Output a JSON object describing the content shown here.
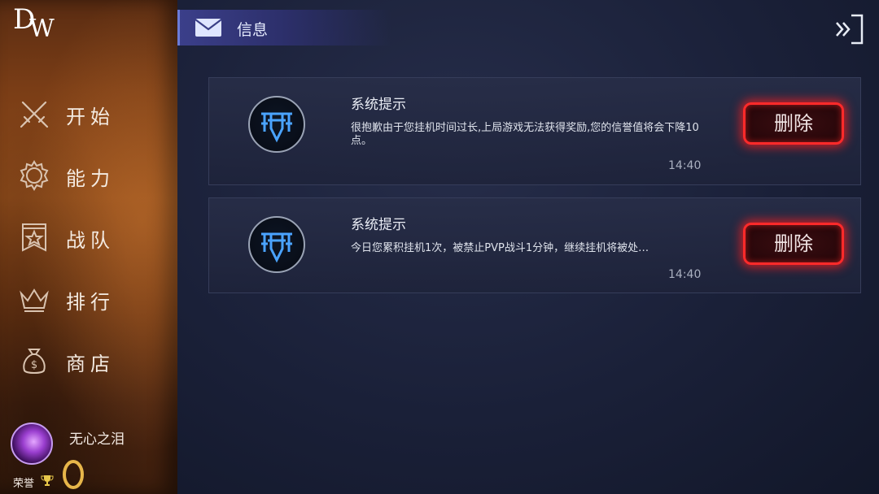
{
  "app": {
    "logo": {
      "d": "D",
      "w": "W"
    }
  },
  "sidebar": {
    "items": [
      {
        "label": "开始",
        "icon": "crossed-swords-icon"
      },
      {
        "label": "能力",
        "icon": "gear-icon"
      },
      {
        "label": "战队",
        "icon": "star-banner-icon"
      },
      {
        "label": "排行",
        "icon": "crown-icon"
      },
      {
        "label": "商店",
        "icon": "money-bag-icon"
      }
    ],
    "profile": {
      "username": "无心之泪",
      "honor_label": "荣誉",
      "honor_icon": "trophy-icon",
      "rank_icon": "gold-ring-icon"
    }
  },
  "header": {
    "title": "信息",
    "icon": "mail-icon",
    "exit_icon": "exit-icon"
  },
  "messages": [
    {
      "title": "系统提示",
      "body": "很抱歉由于您挂机时间过长,上局游戏无法获得奖励,您的信誉值将会下降10点。",
      "time": "14:40",
      "delete_label": "删除"
    },
    {
      "title": "系统提示",
      "body": "今日您累积挂机1次，被禁止PVP战斗1分钟，继续挂机将被处…",
      "time": "14:40",
      "delete_label": "删除"
    }
  ],
  "colors": {
    "accent_red": "#ff2a2a",
    "sidebar_brown": "#7a3d16",
    "emblem_blue": "#4aa3ff"
  }
}
